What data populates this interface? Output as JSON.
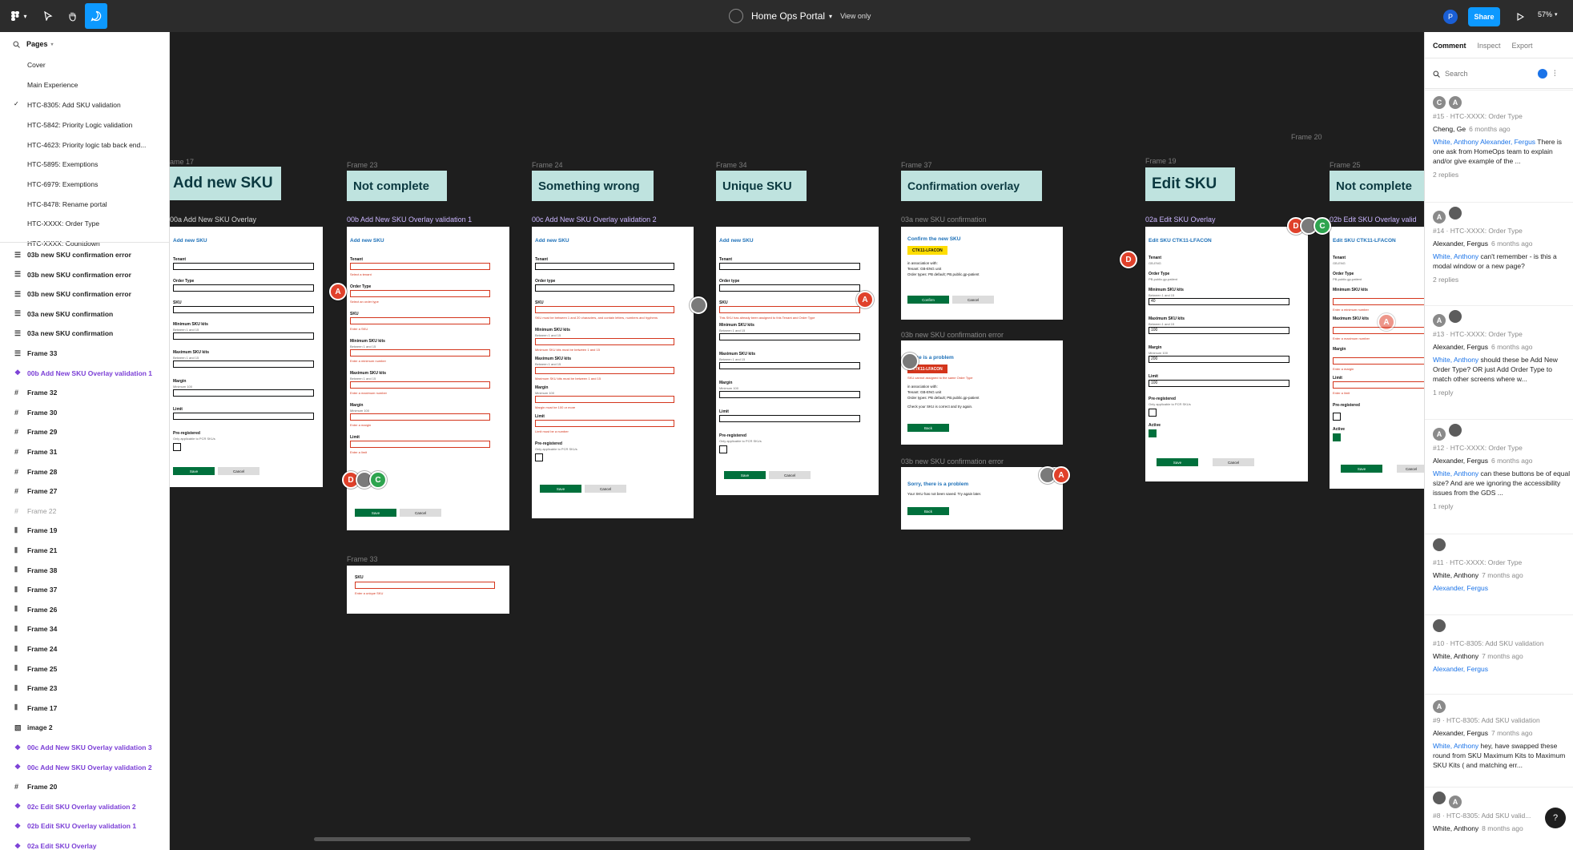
{
  "topbar": {
    "title": "Home Ops Portal",
    "view_mode": "View only",
    "share": "Share",
    "zoom": "57%",
    "user_initial": "P"
  },
  "left": {
    "pages_label": "Pages",
    "pages": [
      {
        "label": "Cover",
        "current": false
      },
      {
        "label": "Main Experience",
        "current": false
      },
      {
        "label": "HTC-8305: Add SKU validation",
        "current": true
      },
      {
        "label": "HTC-5842: Priority Logic validation",
        "current": false
      },
      {
        "label": "HTC-4623: Priority logic tab back end...",
        "current": false
      },
      {
        "label": "HTC-5895: Exemptions",
        "current": false
      },
      {
        "label": "HTC-6979: Exemptions",
        "current": false
      },
      {
        "label": "HTC-8478: Rename portal",
        "current": false
      },
      {
        "label": "HTC-XXXX: Order Type",
        "current": false
      },
      {
        "label": "HTC-XXXX: Countdown",
        "current": false
      }
    ],
    "layers": [
      {
        "label": "03b new SKU confirmation error",
        "icon": "rows-icon",
        "style": "normal"
      },
      {
        "label": "03b new SKU confirmation error",
        "icon": "rows-icon",
        "style": "normal"
      },
      {
        "label": "03b new SKU confirmation error",
        "icon": "rows-icon",
        "style": "normal"
      },
      {
        "label": "03a new SKU confirmation",
        "icon": "rows-icon",
        "style": "normal"
      },
      {
        "label": "03a new SKU confirmation",
        "icon": "rows-icon",
        "style": "normal"
      },
      {
        "label": "Frame 33",
        "icon": "rows-icon",
        "style": "normal"
      },
      {
        "label": "00b Add New SKU Overlay validation 1",
        "icon": "component-icon",
        "style": "purple"
      },
      {
        "label": "Frame 32",
        "icon": "frame-icon",
        "style": "normal"
      },
      {
        "label": "Frame 30",
        "icon": "frame-icon",
        "style": "normal"
      },
      {
        "label": "Frame 29",
        "icon": "frame-icon",
        "style": "normal"
      },
      {
        "label": "Frame 31",
        "icon": "frame-icon",
        "style": "normal"
      },
      {
        "label": "Frame 28",
        "icon": "frame-icon",
        "style": "normal"
      },
      {
        "label": "Frame 27",
        "icon": "frame-icon",
        "style": "normal"
      },
      {
        "label": "Frame 22",
        "icon": "frame-icon",
        "style": "grey"
      },
      {
        "label": "Frame 19",
        "icon": "columns-icon",
        "style": "normal"
      },
      {
        "label": "Frame 21",
        "icon": "columns-icon",
        "style": "normal"
      },
      {
        "label": "Frame 38",
        "icon": "columns-icon",
        "style": "normal"
      },
      {
        "label": "Frame 37",
        "icon": "columns-icon",
        "style": "normal"
      },
      {
        "label": "Frame 26",
        "icon": "columns-icon",
        "style": "normal"
      },
      {
        "label": "Frame 34",
        "icon": "columns-icon",
        "style": "normal"
      },
      {
        "label": "Frame 24",
        "icon": "columns-icon",
        "style": "normal"
      },
      {
        "label": "Frame 25",
        "icon": "columns-icon",
        "style": "normal"
      },
      {
        "label": "Frame 23",
        "icon": "columns-icon",
        "style": "normal"
      },
      {
        "label": "Frame 17",
        "icon": "columns-icon",
        "style": "normal"
      },
      {
        "label": "image 2",
        "icon": "image-icon",
        "style": "normal"
      },
      {
        "label": "00c Add New SKU Overlay validation 3",
        "icon": "component-icon",
        "style": "purple"
      },
      {
        "label": "00c Add New SKU Overlay validation 2",
        "icon": "component-icon",
        "style": "purple"
      },
      {
        "label": "Frame 20",
        "icon": "frame-icon",
        "style": "normal"
      },
      {
        "label": "02c Edit SKU Overlay validation 2",
        "icon": "component-icon",
        "style": "purple"
      },
      {
        "label": "02b Edit SKU Overlay validation 1",
        "icon": "component-icon",
        "style": "purple"
      },
      {
        "label": "02a Edit SKU Overlay",
        "icon": "component-icon",
        "style": "purple"
      }
    ]
  },
  "canvas": {
    "frame_labels": {
      "f17": "ame 17",
      "f23": "Frame 23",
      "f24": "Frame 24",
      "f34": "Frame 34",
      "f37": "Frame 37",
      "f19": "Frame 19",
      "f25": "Frame 25",
      "f20": "Frame 20",
      "f33": "Frame 33"
    },
    "banners": {
      "b1": "Add new SKU",
      "b2": "Not complete",
      "b3": "Something wrong",
      "b4": "Unique SKU",
      "b5": "Confirmation overlay",
      "b6": "Edit SKU",
      "b7": "Not complete"
    },
    "frame_names": {
      "n1": "00a Add New SKU Overlay",
      "n2": "00b Add New SKU Overlay validation 1",
      "n3": "00c Add New SKU Overlay validation 2",
      "n4": "03a new SKU confirmation",
      "n5": "03b new SKU confirmation error",
      "n6": "03b new SKU confirmation error",
      "n7": "02a Edit SKU Overlay",
      "n8": "02b Edit SKU Overlay valid"
    },
    "form": {
      "title_add": "Add new SKU",
      "title_edit": "Edit SKU CTK11-LFACON",
      "title_edit_cut": "Edit SKU CTK11-LFACON",
      "tenant": "Tenant",
      "order_type": "Order Type",
      "order_type_lc": "Order type",
      "sku": "SKU",
      "min_kits": "Minimum SKU kits",
      "max_kits": "Maximum SKU kits",
      "margin": "Margin",
      "limit": "Limit",
      "preregistered": "Pre-registered",
      "prereg_hint": "Only applicable to PCR SKUs",
      "between": "Between 1 and 15",
      "minimum_100": "Minimum 100",
      "save": "Save",
      "cancel": "Cancel",
      "active": "Active",
      "tenant_value": "GB-ENG",
      "order_value": "PB-public.gp-patient",
      "val_40": "40",
      "val_100": "100",
      "val_200": "200",
      "val_100b": "100",
      "sku_value": "SKU",
      "err_tenant": "Select a tenant",
      "err_order": "Select an order type",
      "err_sku": "Enter a SKU",
      "err_min": "Enter a minimum number",
      "err_max": "Enter a maximum number",
      "err_margin": "Enter a margin",
      "err_limit": "Enter a limit",
      "err_sku_len": "SKU must be between 1 and 20 characters, and contain letters, numbers and hyphens",
      "err_min_range": "Minimum SKU kits must be between 1 and 15",
      "err_max_range": "Maximum SKU kits must be between 1 and 15",
      "err_margin_range": "Margin must be 100 or more",
      "err_limit_num": "Limit must be a number",
      "err_unique": "This SKU has already been assigned to this Tenant and Order Type",
      "err_unique_sku": "Enter a unique SKU"
    },
    "confirm": {
      "title": "Confirm the new SKU",
      "tag": "CTK11-LFACON",
      "assoc": "in association with:",
      "tenant_line": "Tenant: GB-ENG unit",
      "order_line": "Order types: PB default; PB.public.gp-patient",
      "confirm": "Confirm",
      "cancel": "Cancel",
      "problem_title": "There is a problem",
      "problem_tag": "CTK11-LFACON",
      "problem_msg": "SKU cannot assigned to the same Order Type",
      "check_msg": "Check your SKU is correct and try again.",
      "back": "Back",
      "sorry_title": "Sorry, there is a problem",
      "sorry_msg": "Your SKU has not been saved. Try again later."
    },
    "pins": {
      "a": "A",
      "d": "D",
      "c": "C"
    }
  },
  "right": {
    "tabs": [
      "Comment",
      "Inspect",
      "Export"
    ],
    "search_placeholder": "Search",
    "comments": [
      {
        "avatars": [
          "C",
          "A"
        ],
        "meta": "#15 · HTC-XXXX: Order Type",
        "author": "Cheng, Ge",
        "when": "6 months ago",
        "mention": "White, Anthony Alexander, Fergus",
        "text": "There is one ask from HomeOps team to explain and/or give example of the ...",
        "replies": "2 replies"
      },
      {
        "avatars": [
          "A",
          "ph"
        ],
        "meta": "#14 · HTC-XXXX: Order Type",
        "author": "Alexander, Fergus",
        "when": "6 months ago",
        "mention": "White, Anthony",
        "text": "can't remember - is this a modal window or a new page?",
        "replies": "2 replies"
      },
      {
        "avatars": [
          "A",
          "ph"
        ],
        "meta": "#13 · HTC-XXXX: Order Type",
        "author": "Alexander, Fergus",
        "when": "6 months ago",
        "mention": "White, Anthony",
        "text": "should these be Add New Order Type? OR just Add Order Type to match other screens where w...",
        "replies": "1 reply"
      },
      {
        "avatars": [
          "A",
          "ph"
        ],
        "meta": "#12 · HTC-XXXX: Order Type",
        "author": "Alexander, Fergus",
        "when": "6 months ago",
        "mention": "White, Anthony",
        "text": "can these buttons be of equal size? And are we ignoring the accessibility issues from the GDS ...",
        "replies": "1 reply"
      },
      {
        "avatars": [
          "ph"
        ],
        "meta": "#11 · HTC-XXXX: Order Type",
        "author": "White, Anthony",
        "when": "7 months ago",
        "mention": "Alexander, Fergus",
        "text": "",
        "replies": ""
      },
      {
        "avatars": [
          "ph"
        ],
        "meta": "#10 · HTC-8305: Add SKU validation",
        "author": "White, Anthony",
        "when": "7 months ago",
        "mention": "Alexander, Fergus",
        "text": "",
        "replies": ""
      },
      {
        "avatars": [
          "A"
        ],
        "meta": "#9 · HTC-8305: Add SKU validation",
        "author": "Alexander, Fergus",
        "when": "7 months ago",
        "mention": "White, Anthony",
        "text": "hey, have swapped these round from SKU Maximum Kits to Maximum SKU Kits ( and matching err...",
        "replies": ""
      },
      {
        "avatars": [
          "ph",
          "A"
        ],
        "meta": "#8 · HTC-8305: Add SKU valid...",
        "author": "White, Anthony",
        "when": "8 months ago",
        "mention": "",
        "text": "",
        "replies": ""
      }
    ],
    "help": "?"
  }
}
